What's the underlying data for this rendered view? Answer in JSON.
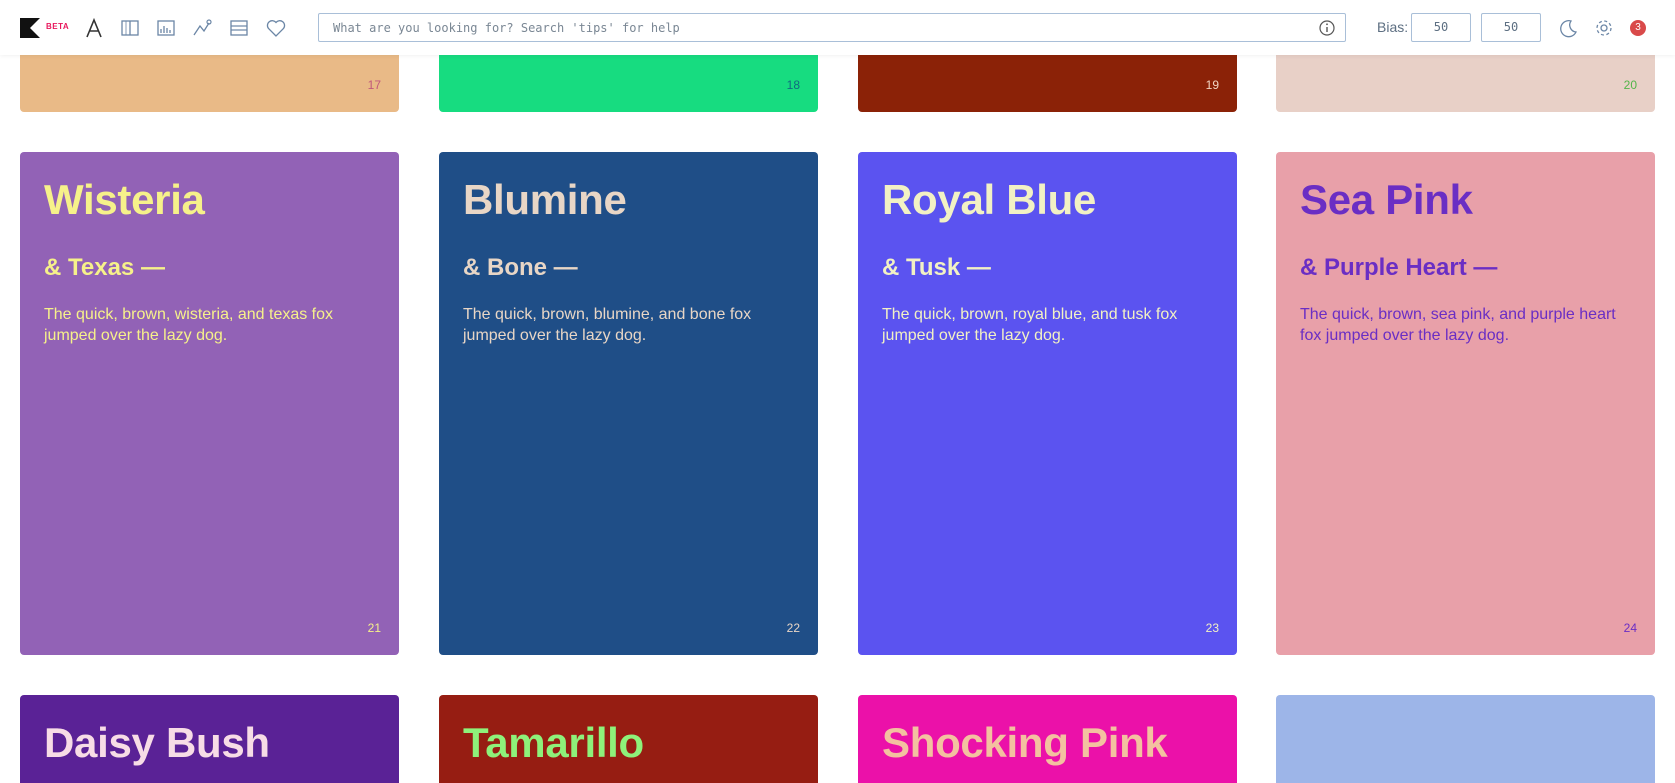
{
  "toolbar": {
    "logo_badge": "BETA",
    "icons": [
      "typography-icon",
      "columns-icon",
      "chart-icon",
      "graph-icon",
      "list-icon",
      "heart-icon"
    ]
  },
  "search": {
    "placeholder": "What are you looking for? Search 'tips' for help",
    "value": ""
  },
  "bias": {
    "label": "Bias:",
    "values": [
      "50",
      "50"
    ]
  },
  "notifications": {
    "count": "3"
  },
  "cards_top_partial": [
    {
      "number": "17",
      "bg": "#e9ba87",
      "fg": "#c0587b"
    },
    {
      "number": "18",
      "bg": "#17dc80",
      "fg": "#116b80"
    },
    {
      "number": "19",
      "bg": "#8b2207",
      "fg": "#f2d6c4"
    },
    {
      "number": "20",
      "bg": "#e8d0c7",
      "fg": "#53b54a"
    }
  ],
  "cards_main": [
    {
      "title": "Wisteria",
      "subtitle": "& Texas —",
      "sample": "The quick, brown, wisteria, and texas fox jumped over the lazy dog.",
      "number": "21",
      "bg": "#9262b6",
      "fg": "#f6f18a"
    },
    {
      "title": "Blumine",
      "subtitle": "& Bone —",
      "sample": "The quick, brown, blumine, and bone fox jumped over the lazy dog.",
      "number": "22",
      "bg": "#1f4e87",
      "fg": "#e8d6c6"
    },
    {
      "title": "Royal Blue",
      "subtitle": "& Tusk —",
      "sample": "The quick, brown, royal blue, and tusk fox jumped over the lazy dog.",
      "number": "23",
      "bg": "#5b53f0",
      "fg": "#f2f1c4"
    },
    {
      "title": "Sea Pink",
      "subtitle": "& Purple Heart —",
      "sample": "The quick, brown, sea pink, and purple heart fox jumped over the lazy dog.",
      "number": "24",
      "bg": "#e8a0a9",
      "fg": "#6a2ec4"
    }
  ],
  "cards_bottom_partial": [
    {
      "title": "Daisy Bush",
      "bg": "#5a2296",
      "fg": "#f7dce6"
    },
    {
      "title": "Tamarillo",
      "bg": "#961d12",
      "fg": "#8ef17a"
    },
    {
      "title": "Shocking Pink",
      "bg": "#eb11a9",
      "fg": "#f3c1a0"
    },
    {
      "title": "",
      "bg": "#9db5e8",
      "fg": "#9db5e8"
    }
  ]
}
